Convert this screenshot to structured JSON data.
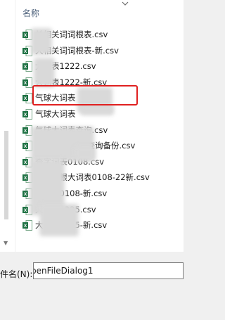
{
  "list": {
    "column_header": "名称",
    "files": [
      "关相关词词根表.csv",
      "大相关词词根表-新.csv",
      "大词表1222.csv",
      "大词表1222-新.csv",
      "气球大词表",
      "气球大词表",
      "气球大词表查询.csv",
      "表查询备份.csv",
      "查字词表0108.csv",
      "气球词根大词表0108-22新.csv",
      "大词表0108-新.csv",
      "大词表1225.csv",
      "大词表1225-新.csv"
    ],
    "selected_index": 4
  },
  "bottom": {
    "filename_label": "件名(N):",
    "filename_value": "penFileDialog1"
  },
  "colors": {
    "highlight": "#e02020",
    "excel_green": "#1f7244"
  }
}
